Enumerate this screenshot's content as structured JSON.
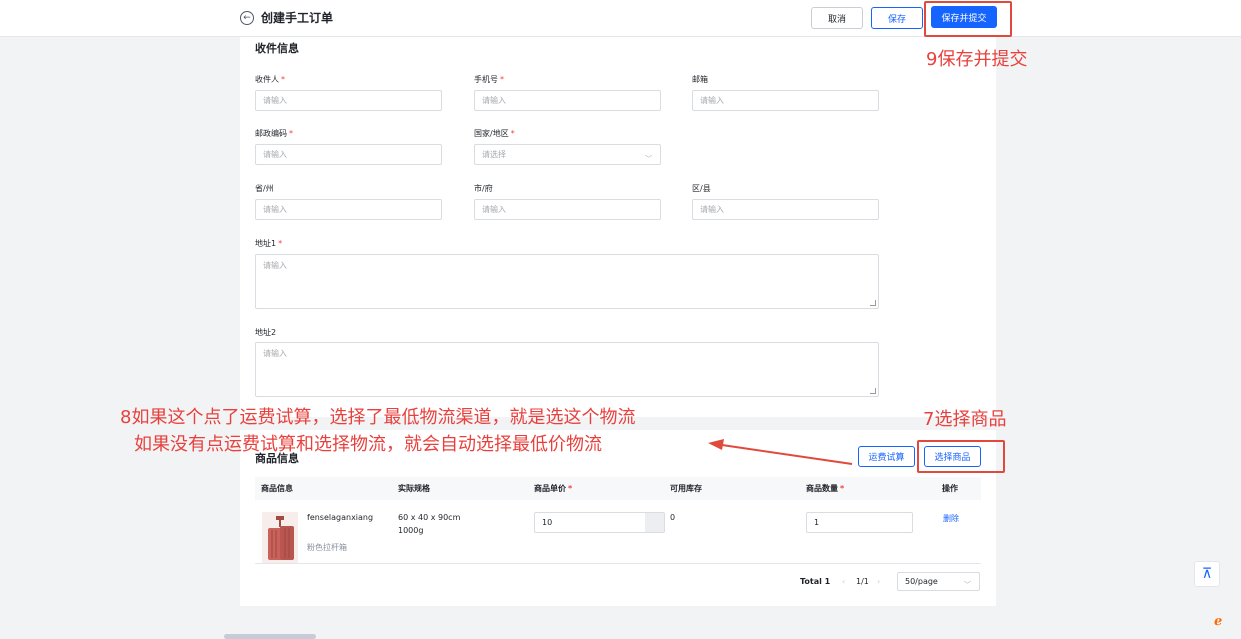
{
  "header": {
    "back_icon": "arrow-left-icon",
    "title": "创建手工订单",
    "cancel": "取消",
    "save": "保存",
    "save_submit": "保存并提交"
  },
  "recipient": {
    "title": "收件信息",
    "fields": {
      "name": {
        "label": "收件人",
        "placeholder": "请输入",
        "required": true
      },
      "phone": {
        "label": "手机号",
        "placeholder": "请输入",
        "required": true
      },
      "email": {
        "label": "邮箱",
        "placeholder": "请输入"
      },
      "zip": {
        "label": "邮政编码",
        "placeholder": "请输入",
        "required": true
      },
      "country": {
        "label": "国家/地区",
        "placeholder": "请选择",
        "required": true
      },
      "province": {
        "label": "省/州",
        "placeholder": "请输入"
      },
      "city": {
        "label": "市/府",
        "placeholder": "请输入"
      },
      "district": {
        "label": "区/县",
        "placeholder": "请输入"
      },
      "address1": {
        "label": "地址1",
        "placeholder": "请输入",
        "required": true
      },
      "address2": {
        "label": "地址2",
        "placeholder": "请输入"
      }
    }
  },
  "products": {
    "title": "商品信息",
    "freight_btn": "运费试算",
    "select_btn": "选择商品",
    "columns": [
      "商品信息",
      "实际规格",
      "商品单价",
      "可用库存",
      "商品数量",
      "操作"
    ],
    "rows": [
      {
        "sku": "fenselaganxiang",
        "name": "粉色拉杆箱",
        "size": "60 x 40 x 90cm",
        "weight": "1000g",
        "price": "10",
        "stock": "0",
        "qty": "1",
        "action": "删除"
      }
    ],
    "pagination": {
      "total": "Total 1",
      "page": "1/1",
      "page_size": "50/page"
    }
  },
  "annotations": {
    "save_submit_note": "9保存并提交",
    "select_product_note": "7选择商品",
    "freight_note_line1": "8如果这个点了运费试算，选择了最低物流渠道，就是选这个物流",
    "freight_note_line2": "如果没有点运费试算和选择物流，就会自动选择最低价物流"
  },
  "colors": {
    "primary": "#1664ff",
    "annotation_red": "#e8413d",
    "required": "#f53f3f"
  }
}
